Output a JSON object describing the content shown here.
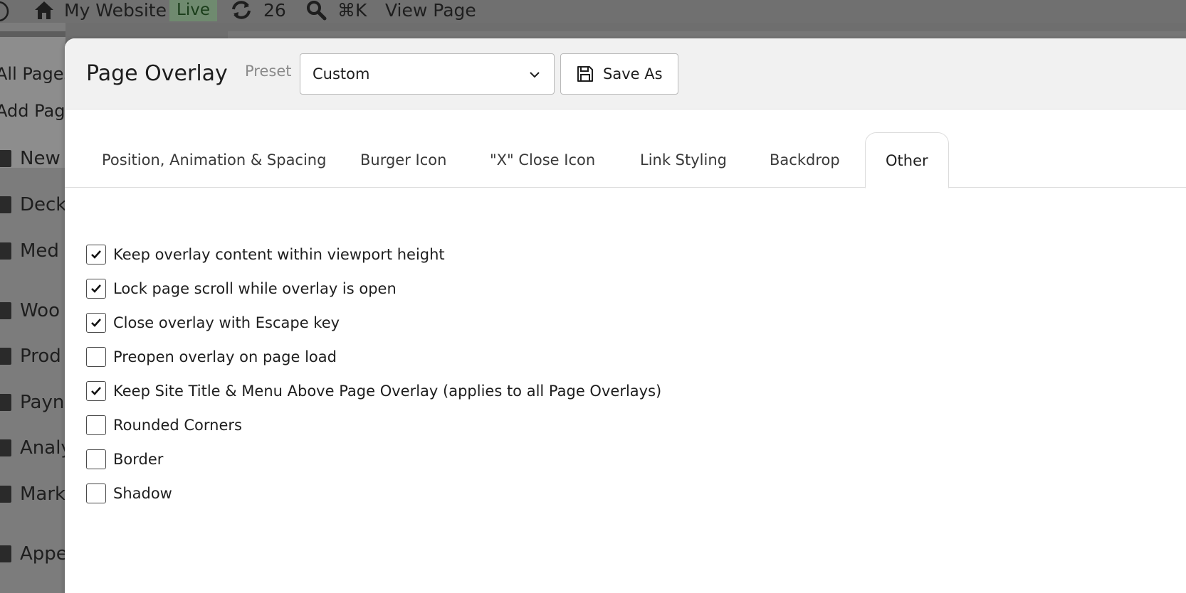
{
  "adminbar": {
    "site_name": "My Website",
    "status_badge": "Live",
    "updates_count": "26",
    "shortcut": "⌘K",
    "view_page": "View Page"
  },
  "sidebar": {
    "submenu": [
      "All Pages",
      "Add Page"
    ],
    "items": [
      {
        "label": "New",
        "icon": "megaphone-icon"
      },
      {
        "label": "Deck",
        "icon": "deck-icon"
      },
      {
        "label": "Med",
        "icon": "media-icon"
      },
      {
        "label": "Woo",
        "icon": "woo-icon"
      },
      {
        "label": "Prod",
        "icon": "products-icon"
      },
      {
        "label": "Payn",
        "icon": "payments-icon"
      },
      {
        "label": "Analy",
        "icon": "analytics-icon"
      },
      {
        "label": "Mark",
        "icon": "marketing-icon"
      },
      {
        "label": "Appe",
        "icon": "appearance-icon"
      }
    ]
  },
  "modal": {
    "title": "Page Overlay",
    "preset_label": "Preset",
    "preset_value": "Custom",
    "save_as_label": "Save As",
    "tabs": [
      {
        "label": "Position, Animation & Spacing",
        "active": false
      },
      {
        "label": "Burger Icon",
        "active": false
      },
      {
        "label": "\"X\" Close Icon",
        "active": false
      },
      {
        "label": "Link Styling",
        "active": false
      },
      {
        "label": "Backdrop",
        "active": false
      },
      {
        "label": "Other",
        "active": true
      }
    ],
    "options": [
      {
        "label": "Keep overlay content within viewport height",
        "checked": true
      },
      {
        "label": "Lock page scroll while overlay is open",
        "checked": true
      },
      {
        "label": "Close overlay with Escape key",
        "checked": true
      },
      {
        "label": "Preopen overlay on page load",
        "checked": false
      },
      {
        "label": "Keep Site Title & Menu Above Page Overlay (applies to all Page Overlays)",
        "checked": true
      },
      {
        "label": "Rounded Corners",
        "checked": false
      },
      {
        "label": "Border",
        "checked": false
      },
      {
        "label": "Shadow",
        "checked": false
      }
    ]
  },
  "colors": {
    "backdrop": "#6e6e6e",
    "header_bg": "#f1f1f1",
    "text": "#1e1e1e",
    "border": "#b9b9b9"
  }
}
